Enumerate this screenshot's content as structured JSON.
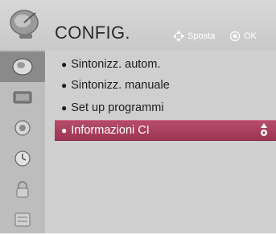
{
  "header": {
    "title": "CONFIG.",
    "icon": "satellite-dish-icon",
    "hints": [
      {
        "icon": "move-arrows-icon",
        "label": "Sposta"
      },
      {
        "icon": "ok-button-icon",
        "label": "OK"
      }
    ]
  },
  "sidebar": {
    "items": [
      {
        "icon": "setup-disc-icon",
        "active": true
      },
      {
        "icon": "picture-icon",
        "active": false
      },
      {
        "icon": "audio-icon",
        "active": false
      },
      {
        "icon": "clock-icon",
        "active": false
      },
      {
        "icon": "lock-icon",
        "active": false
      },
      {
        "icon": "option-icon",
        "active": false
      }
    ]
  },
  "menu": {
    "items": [
      {
        "label": "Sintonizz. autom.",
        "selected": false
      },
      {
        "label": "Sintonizz. manuale",
        "selected": false
      },
      {
        "label": "Set up programmi",
        "selected": false
      },
      {
        "label": "Informazioni CI",
        "selected": true
      }
    ]
  },
  "colors": {
    "background": "#cfcfcf",
    "sidebar": "#bdbdbd",
    "sidebar_active": "#8a8a8a",
    "selection": "#a63b5b"
  }
}
